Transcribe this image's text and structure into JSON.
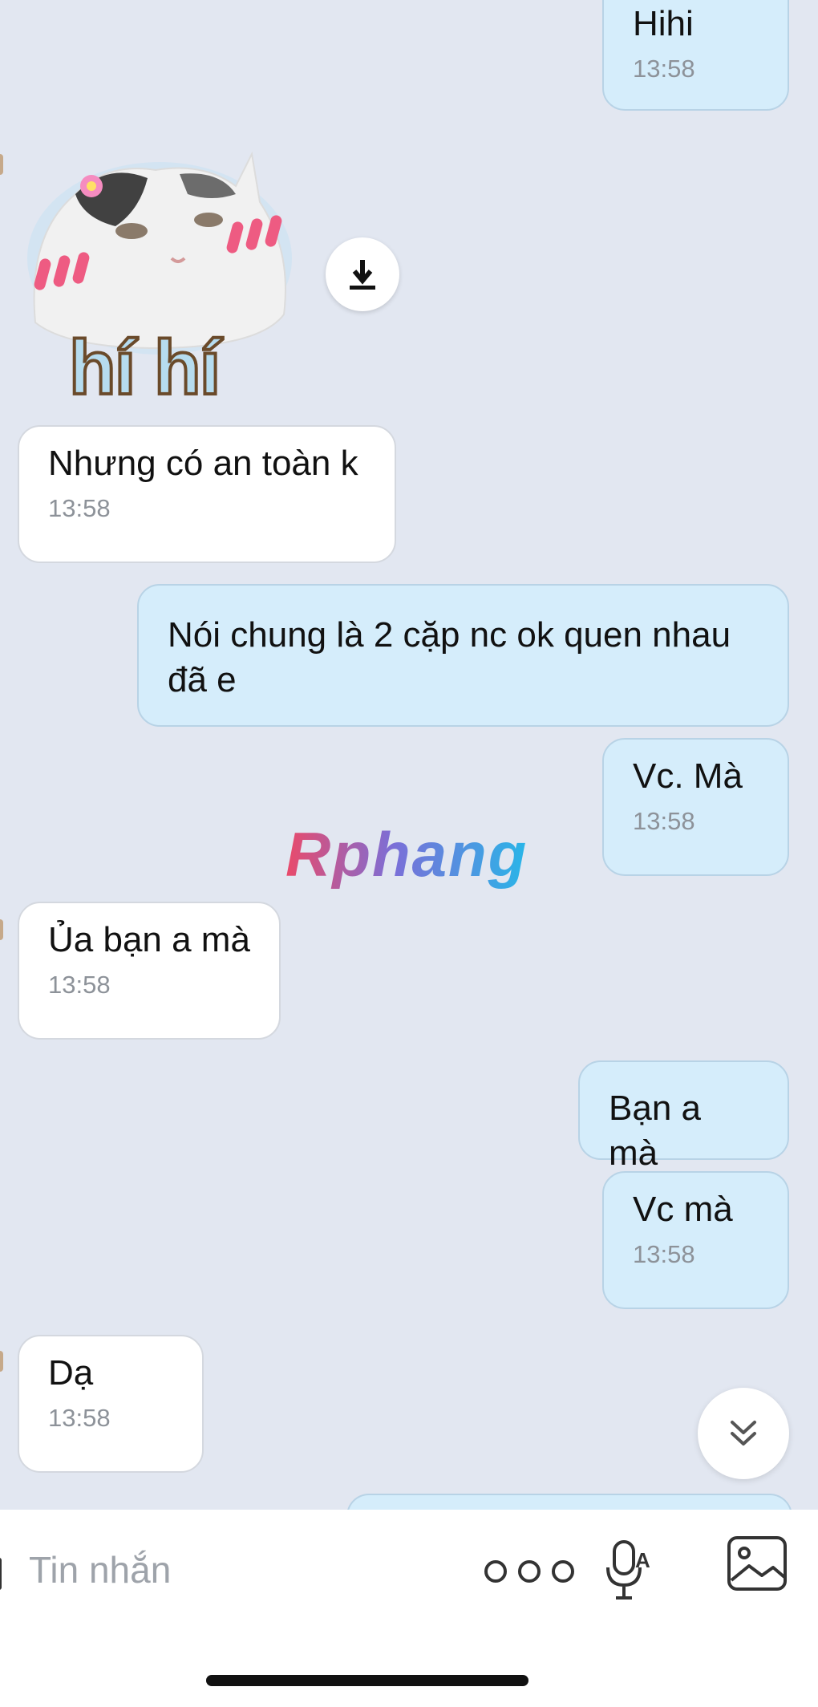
{
  "messages": [
    {
      "id": "m1",
      "side": "out",
      "text": "Hihi",
      "time": "13:58"
    },
    {
      "id": "m2",
      "side": "in",
      "text": "Nhưng có an toàn k",
      "time": "13:58"
    },
    {
      "id": "m3",
      "side": "out",
      "text": "Nói chung là 2 cặp nc ok quen nhau\nđã e",
      "time": ""
    },
    {
      "id": "m4",
      "side": "out",
      "text": "Vc. Mà",
      "time": "13:58"
    },
    {
      "id": "m5",
      "side": "in",
      "text": "Ủa bạn a mà",
      "time": "13:58"
    },
    {
      "id": "m6",
      "side": "out",
      "text": "Bạn a mà",
      "time": ""
    },
    {
      "id": "m7",
      "side": "out",
      "text": "Vc mà",
      "time": "13:58"
    },
    {
      "id": "m8",
      "side": "in",
      "text": "Dạ",
      "time": "13:58"
    }
  ],
  "sticker": {
    "caption": "hí hí"
  },
  "watermark": "Rphang",
  "composer": {
    "placeholder": "Tin nhắn"
  },
  "icons": {
    "download": "download-icon",
    "scroll_down": "chevron-double-down-icon",
    "more": "more-dots-icon",
    "voice": "voice-to-text-icon",
    "image": "image-icon"
  },
  "colors": {
    "outgoing": "#d5edfb",
    "incoming": "#ffffff",
    "background": "#e2e7f1"
  }
}
